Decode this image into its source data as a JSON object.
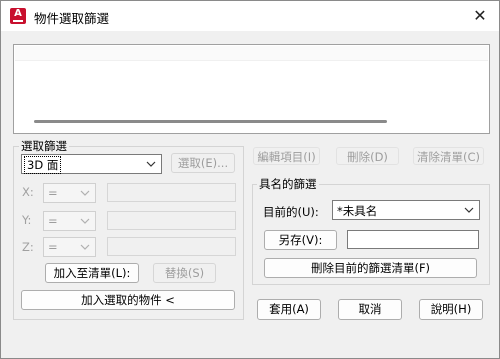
{
  "window": {
    "title": "物件選取篩選",
    "close_glyph": "✕",
    "app_icon_letter": "A"
  },
  "filter_group": {
    "legend": "選取篩選",
    "object_type": "3D 面",
    "select_button": "選取(E)...",
    "x_label": "X:",
    "y_label": "Y:",
    "z_label": "Z:",
    "operator_value": "=",
    "add_to_list_button": "加入至清單(L):",
    "replace_button": "替換(S)",
    "add_selected_button": "加入選取的物件 <"
  },
  "toolbar": {
    "edit_item": "編輯項目(I)",
    "delete": "刪除(D)",
    "clear_list": "清除清單(C)"
  },
  "named_group": {
    "legend": "具名的篩選",
    "current_label": "目前的(U):",
    "current_value": "*未具名",
    "save_as_button": "另存(V):",
    "save_as_value": "",
    "delete_current_button": "刪除目前的篩選清單(F)"
  },
  "footer": {
    "apply_button": "套用(A)",
    "cancel_button": "取消",
    "help_button": "說明(H)"
  },
  "colors": {
    "app_icon": "#c8102e",
    "disabled_text": "#9d9d9d"
  },
  "icons": {
    "close": "close-icon",
    "dropdown": "chevron-down-icon",
    "app": "autocad-logo-icon"
  }
}
